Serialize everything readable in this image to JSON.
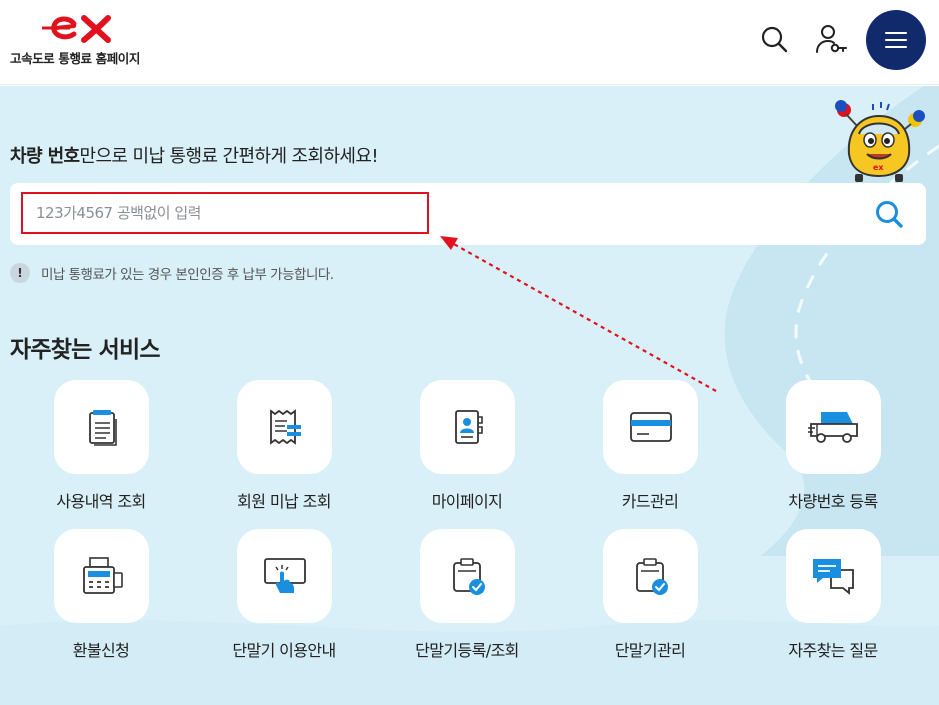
{
  "header": {
    "logo_alt": "ex",
    "site_name": "고속도로 통행료 홈페이지",
    "search_icon": "search-icon",
    "login_icon": "user-key-icon",
    "menu_icon": "hamburger-menu-icon"
  },
  "lookup": {
    "title_bold": "차량 번호",
    "title_rest": "만으로 미납 통행료 간편하게 조회하세요!",
    "placeholder": "123가4567 공백없이 입력",
    "notice_icon": "!",
    "notice": "미납 통행료가 있는 경우 본인인증 후 납부 가능합니다."
  },
  "services": {
    "title": "자주찾는 서비스",
    "items": [
      {
        "label": "사용내역 조회",
        "icon": "document-list-icon"
      },
      {
        "label": "회원 미납 조회",
        "icon": "receipt-icon"
      },
      {
        "label": "마이페이지",
        "icon": "profile-card-icon"
      },
      {
        "label": "카드관리",
        "icon": "credit-card-icon"
      },
      {
        "label": "차량번호 등록",
        "icon": "truck-icon"
      },
      {
        "label": "환불신청",
        "icon": "cash-register-icon"
      },
      {
        "label": "단말기 이용안내",
        "icon": "touch-screen-icon"
      },
      {
        "label": "단말기등록/조회",
        "icon": "device-check-icon"
      },
      {
        "label": "단말기관리",
        "icon": "device-manage-icon"
      },
      {
        "label": "자주찾는 질문",
        "icon": "chat-bubbles-icon"
      }
    ]
  },
  "colors": {
    "brand_red": "#e0121d",
    "brand_navy": "#102a6b",
    "accent_blue": "#1a8fe0",
    "background": "#d9f0f8"
  }
}
